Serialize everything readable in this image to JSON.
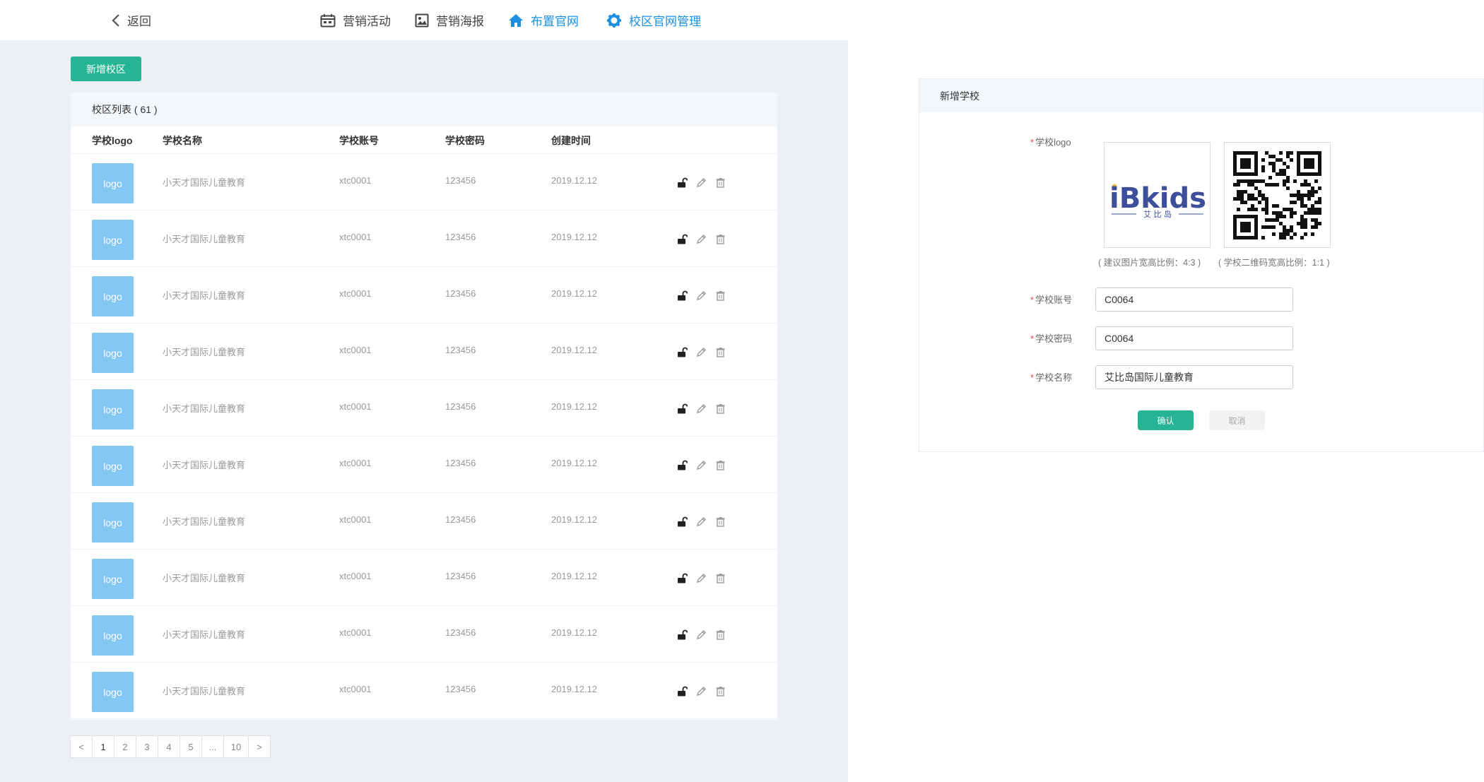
{
  "nav": {
    "back": "返回",
    "items": [
      {
        "label": "营销活动",
        "icon": "calendar-icon"
      },
      {
        "label": "营销海报",
        "icon": "image-icon"
      },
      {
        "label": "布置官网",
        "icon": "home-icon",
        "active": true
      },
      {
        "label": "校区官网管理",
        "icon": "gear-icon"
      }
    ],
    "active_color": "#1d8fe0"
  },
  "add_campus_label": "新增校区",
  "campus_list": {
    "title": "校区列表 ( 61 )",
    "columns": [
      "学校logo",
      "学校名称",
      "学校账号",
      "学校密码",
      "创建时间"
    ],
    "rows": [
      {
        "logo": "logo",
        "name": "小天才国际儿童教育",
        "account": "xtc0001",
        "password": "123456",
        "created": "2019.12.12"
      },
      {
        "logo": "logo",
        "name": "小天才国际儿童教育",
        "account": "xtc0001",
        "password": "123456",
        "created": "2019.12.12"
      },
      {
        "logo": "logo",
        "name": "小天才国际儿童教育",
        "account": "xtc0001",
        "password": "123456",
        "created": "2019.12.12"
      },
      {
        "logo": "logo",
        "name": "小天才国际儿童教育",
        "account": "xtc0001",
        "password": "123456",
        "created": "2019.12.12"
      },
      {
        "logo": "logo",
        "name": "小天才国际儿童教育",
        "account": "xtc0001",
        "password": "123456",
        "created": "2019.12.12"
      },
      {
        "logo": "logo",
        "name": "小天才国际儿童教育",
        "account": "xtc0001",
        "password": "123456",
        "created": "2019.12.12"
      },
      {
        "logo": "logo",
        "name": "小天才国际儿童教育",
        "account": "xtc0001",
        "password": "123456",
        "created": "2019.12.12"
      },
      {
        "logo": "logo",
        "name": "小天才国际儿童教育",
        "account": "xtc0001",
        "password": "123456",
        "created": "2019.12.12"
      },
      {
        "logo": "logo",
        "name": "小天才国际儿童教育",
        "account": "xtc0001",
        "password": "123456",
        "created": "2019.12.12"
      },
      {
        "logo": "logo",
        "name": "小天才国际儿童教育",
        "account": "xtc0001",
        "password": "123456",
        "created": "2019.12.12"
      }
    ],
    "row_actions": [
      "unlock-icon",
      "edit-icon",
      "delete-icon"
    ]
  },
  "pagination": {
    "prev": "<",
    "pages": [
      "1",
      "2",
      "3",
      "4",
      "5",
      "...",
      "10"
    ],
    "current": "1",
    "next": ">"
  },
  "form": {
    "title": "新增学校",
    "logo_label": "学校logo",
    "logo_text": "iBkids",
    "logo_subtext": "艾 比 岛",
    "logo_hint": "( 建议图片宽高比例：4:3 )",
    "qr_hint": "( 学校二维码宽高比例：1:1 )",
    "account_label": "学校账号",
    "account_value": "C0064",
    "password_label": "学校密码",
    "password_value": "C0064",
    "name_label": "学校名称",
    "name_value": "艾比岛国际儿童教育",
    "confirm": "确认",
    "cancel": "取消"
  },
  "colors": {
    "primary": "#26b594",
    "logo_placeholder": "#82c8f2",
    "brand_blue": "#3d4e9a",
    "required": "#e84b4b"
  }
}
